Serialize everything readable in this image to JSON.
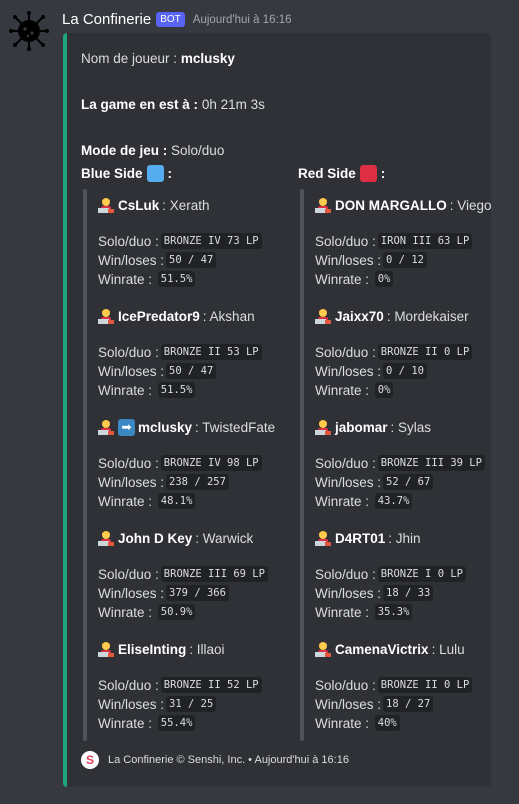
{
  "message": {
    "username": "La Confinerie",
    "bot_badge": "BOT",
    "timestamp": "Aujourd'hui à 16:16",
    "avatar_icon": "virus-icon"
  },
  "embed": {
    "accent_color": "#1fa67a",
    "player_label": "Nom de joueur :",
    "player_value": "mclusky",
    "game_label": "La game en est à :",
    "game_value": "0h 21m 3s",
    "mode_label": "Mode de jeu :",
    "mode_value": "Solo/duo",
    "stat_labels": {
      "rank": "Solo/duo :",
      "wl": "Win/loses :",
      "winrate": "Winrate :"
    },
    "teams": [
      {
        "title": "Blue Side",
        "suffix": ":",
        "color": "#55acee",
        "players": [
          {
            "name": "CsLuk",
            "champion": ": Xerath",
            "rank": "BRONZE IV 73 LP",
            "wl": "50 / 47",
            "winrate": "51.5%"
          },
          {
            "name": "IcePredator9",
            "champion": ": Akshan",
            "rank": "BRONZE II 53 LP",
            "wl": "50 / 47",
            "winrate": "51.5%"
          },
          {
            "name": "mclusky",
            "champion": ": TwistedFate",
            "rank": "BRONZE IV 98 LP",
            "wl": "238 / 257",
            "winrate": "48.1%",
            "arrow": "➡"
          },
          {
            "name": "John D Key",
            "champion": ": Warwick",
            "rank": "BRONZE III 69 LP",
            "wl": "379 / 366",
            "winrate": "50.9%"
          },
          {
            "name": "EliseInting",
            "champion": ": Illaoi",
            "rank": "BRONZE II 52 LP",
            "wl": "31 / 25",
            "winrate": "55.4%"
          }
        ]
      },
      {
        "title": "Red Side",
        "suffix": ":",
        "color": "#dd2e44",
        "players": [
          {
            "name": "DON MARGALLO",
            "champion": ": Viego",
            "rank": "IRON III 63 LP",
            "wl": "0 / 12",
            "winrate": "0%"
          },
          {
            "name": "Jaixx70",
            "champion": ": Mordekaiser",
            "rank": "BRONZE II 0 LP",
            "wl": "0 / 10",
            "winrate": "0%"
          },
          {
            "name": "jabomar",
            "champion": ": Sylas",
            "rank": "BRONZE III 39 LP",
            "wl": "52 / 67",
            "winrate": "43.7%"
          },
          {
            "name": "D4RT01",
            "champion": ": Jhin",
            "rank": "BRONZE I 0 LP",
            "wl": "18 / 33",
            "winrate": "35.3%"
          },
          {
            "name": "CamenaVictrix",
            "champion": ": Lulu",
            "rank": "BRONZE II 0 LP",
            "wl": "18 / 27",
            "winrate": "40%"
          }
        ]
      }
    ],
    "footer": {
      "icon_letter": "S",
      "text": "La Confinerie © Senshi, Inc. • Aujourd'hui à 16:16"
    }
  }
}
